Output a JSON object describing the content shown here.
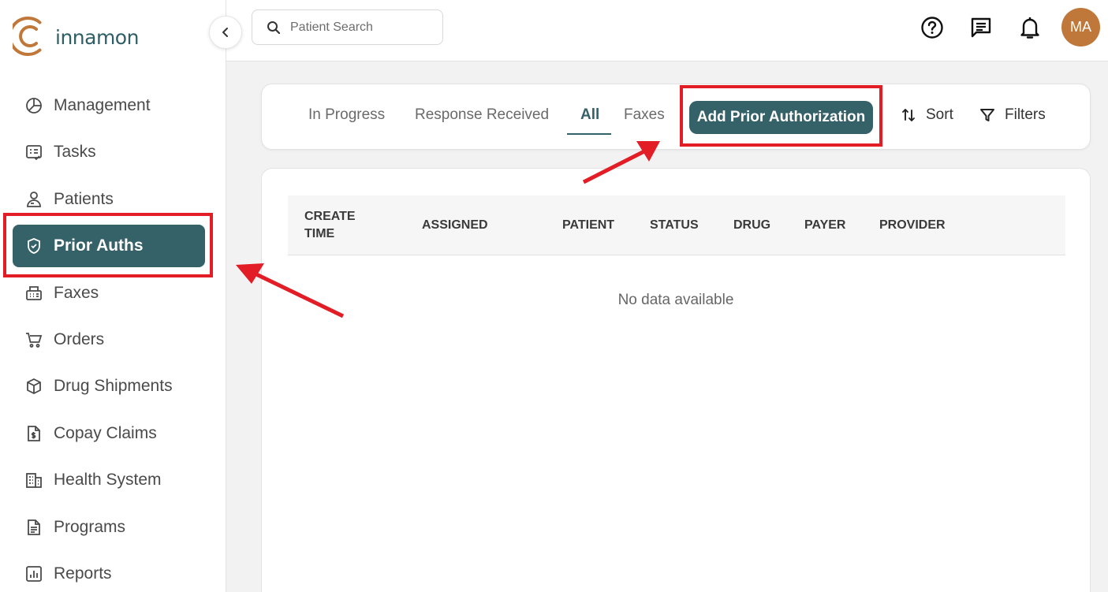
{
  "brand": {
    "name": "innamon",
    "color": "#356168",
    "logo_color": "#c0783a"
  },
  "sidebar": {
    "items": [
      {
        "label": "Management",
        "icon": "chart-pie-icon"
      },
      {
        "label": "Tasks",
        "icon": "task-list-icon"
      },
      {
        "label": "Patients",
        "icon": "patient-icon"
      },
      {
        "label": "Prior Auths",
        "icon": "shield-check-icon",
        "active": true
      },
      {
        "label": "Faxes",
        "icon": "fax-icon"
      },
      {
        "label": "Orders",
        "icon": "cart-icon"
      },
      {
        "label": "Drug Shipments",
        "icon": "package-icon"
      },
      {
        "label": "Copay Claims",
        "icon": "dollar-document-icon"
      },
      {
        "label": "Health System",
        "icon": "building-icon"
      },
      {
        "label": "Programs",
        "icon": "document-icon"
      },
      {
        "label": "Reports",
        "icon": "bar-chart-icon"
      }
    ]
  },
  "topbar": {
    "search_placeholder": "Patient Search",
    "avatar_initials": "MA"
  },
  "tabs": {
    "items": [
      "In Progress",
      "Response Received",
      "All",
      "Faxes"
    ],
    "active_index": 2,
    "add_button": "Add Prior Authorization",
    "sort_label": "Sort",
    "filters_label": "Filters"
  },
  "table": {
    "columns": [
      "CREATE TIME",
      "ASSIGNED",
      "PATIENT",
      "STATUS",
      "DRUG",
      "PAYER",
      "PROVIDER"
    ],
    "empty_text": "No data available"
  },
  "annotation_color": "#e21d25"
}
